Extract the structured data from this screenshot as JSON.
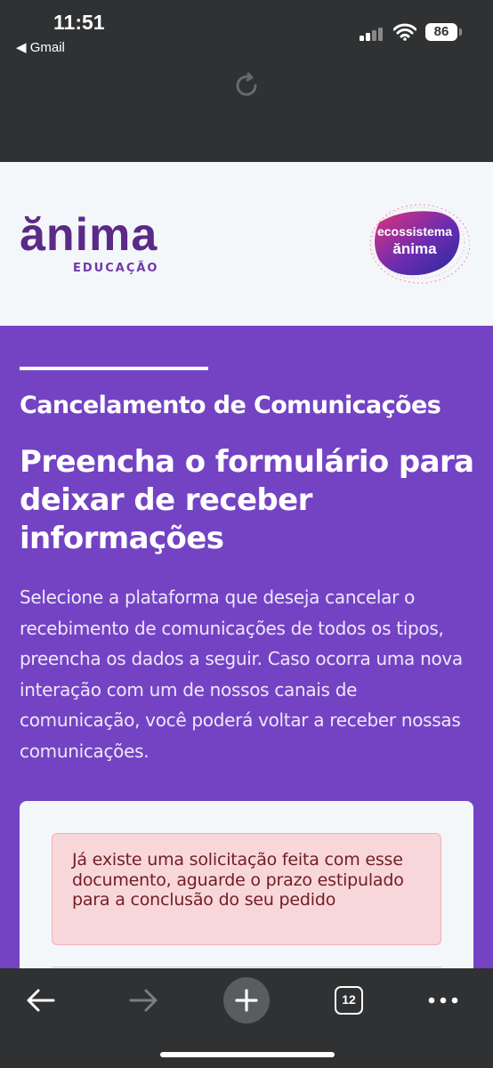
{
  "status_bar": {
    "time": "11:51",
    "back_app": "◀ Gmail",
    "battery": "86"
  },
  "header": {
    "logo_word": "ănima",
    "logo_sub": "EDUCAÇÃO",
    "eco_line1": "ecossistema",
    "eco_line2": "ănima"
  },
  "hero": {
    "section_label": "Cancelamento de Comunicações",
    "headline": "Preencha o formulário para deixar de receber informações",
    "description": "Selecione a plataforma que deseja cancelar o recebimento de comunicações de todos os tipos, preencha os dados a seguir. Caso ocorra uma nova interação com um de nossos canais de comunicação, você poderá voltar a receber nossas comunicações."
  },
  "form": {
    "alert_message": "Já existe uma solicitação feita com esse documento, aguarde o prazo estipulado para a conclusão do seu pedido"
  },
  "toolbar": {
    "tab_count": "12"
  },
  "colors": {
    "purple": "#7443c4",
    "dark": "#2f3133",
    "alert_bg": "#f8d7da",
    "alert_text": "#721c24"
  }
}
